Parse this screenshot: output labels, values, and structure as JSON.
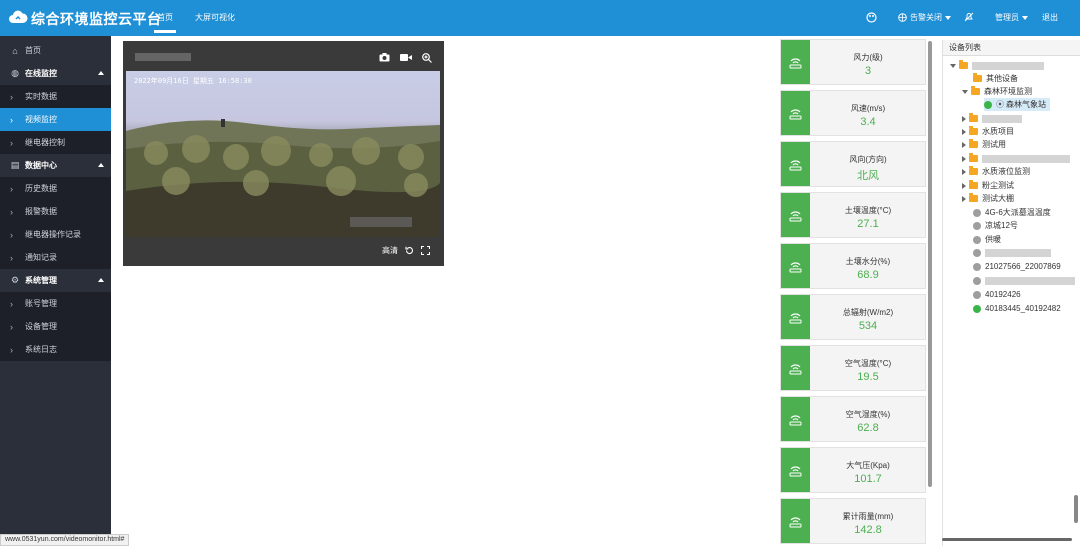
{
  "header": {
    "title": "综合环境监控云平台",
    "tabs": [
      {
        "label": "首页",
        "active": true
      },
      {
        "label": "大屏可视化",
        "active": false
      }
    ],
    "alarm_label": "告警关闭",
    "user_label": "管理员",
    "logout_label": "退出",
    "accent_color": "#1f8fd6"
  },
  "sidebar": {
    "items": [
      {
        "label": "首页",
        "type": "top",
        "icon": "home-icon"
      },
      {
        "label": "在线监控",
        "type": "section",
        "icon": "globe-icon"
      },
      {
        "label": "实时数据",
        "type": "sub"
      },
      {
        "label": "视频监控",
        "type": "sub",
        "active": true
      },
      {
        "label": "继电器控制",
        "type": "sub"
      },
      {
        "label": "数据中心",
        "type": "section",
        "icon": "database-icon"
      },
      {
        "label": "历史数据",
        "type": "sub"
      },
      {
        "label": "报警数据",
        "type": "sub"
      },
      {
        "label": "继电器操作记录",
        "type": "sub"
      },
      {
        "label": "通知记录",
        "type": "sub"
      },
      {
        "label": "系统管理",
        "type": "section",
        "icon": "gear-icon"
      },
      {
        "label": "账号管理",
        "type": "sub"
      },
      {
        "label": "设备管理",
        "type": "sub"
      },
      {
        "label": "系统日志",
        "type": "sub"
      }
    ]
  },
  "statusbar": {
    "url": "www.0531yun.com/videomonitor.html#"
  },
  "video": {
    "timestamp": "2022年09月16日 星期五 16:58:30",
    "quality_label": "高清"
  },
  "sensors": [
    {
      "label": "风力(级)",
      "value": "3"
    },
    {
      "label": "风速(m/s)",
      "value": "3.4"
    },
    {
      "label": "风向(方向)",
      "value": "北风"
    },
    {
      "label": "土壤温度(°C)",
      "value": "27.1"
    },
    {
      "label": "土壤水分(%)",
      "value": "68.9"
    },
    {
      "label": "总辐射(W/m2)",
      "value": "534"
    },
    {
      "label": "空气温度(°C)",
      "value": "19.5"
    },
    {
      "label": "空气湿度(%)",
      "value": "62.8"
    },
    {
      "label": "大气压(Kpa)",
      "value": "101.7"
    },
    {
      "label": "累计雨量(mm)",
      "value": "142.8"
    }
  ],
  "sensor_color": "#4caf50",
  "tree": {
    "title": "设备列表",
    "nodes": [
      {
        "label": "其他设备"
      },
      {
        "label": "森林环境监测"
      },
      {
        "label": "森林气象站"
      },
      {
        "label": "水质项目"
      },
      {
        "label": "测试用"
      },
      {
        "label": "水质液位监测"
      },
      {
        "label": "粉尘测试"
      },
      {
        "label": "测试大棚"
      },
      {
        "label": "4G-6大派墓温温度"
      },
      {
        "label": "凉城12号"
      },
      {
        "label": "供暖"
      },
      {
        "label": "21027566_22007869"
      },
      {
        "label": "40192426"
      },
      {
        "label": "40183445_40192482"
      }
    ]
  }
}
